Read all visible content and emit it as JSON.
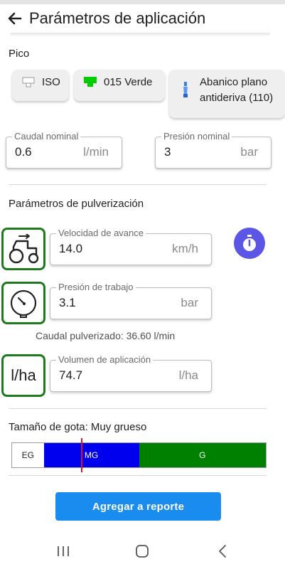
{
  "appbar": {
    "title": "Parámetros de aplicación"
  },
  "nozzle": {
    "section_label": "Pico",
    "chips": [
      {
        "label": "ISO",
        "icon": "nozzle-outline-icon",
        "color": "#ffffff"
      },
      {
        "label": "015 Verde",
        "icon": "nozzle-green-icon",
        "color": "#00cc00"
      },
      {
        "label_line1": "Abanico plano",
        "label_line2": "antideriva (110)",
        "icon": "fan-nozzle-icon",
        "color": "#3b7ee8"
      }
    ],
    "caudal_nominal": {
      "label": "Caudal nominal",
      "value": "0.6",
      "unit": "l/min"
    },
    "presion_nominal": {
      "label": "Presión nominal",
      "value": "3",
      "unit": "bar"
    }
  },
  "spray": {
    "section_label": "Parámetros de pulverización",
    "velocidad": {
      "label": "Velocidad de avance",
      "value": "14.0",
      "unit": "km/h",
      "icon": "tractor-icon"
    },
    "presion_trabajo": {
      "label": "Presión de trabajo",
      "value": "3.1",
      "unit": "bar",
      "icon": "pressure-gauge-icon"
    },
    "caudal_pulverizado": "Caudal pulverizado: 36.60 l/min",
    "volumen": {
      "label": "Volumen de aplicación",
      "value": "74.7",
      "unit": "l/ha",
      "icon_text": "l/ha"
    },
    "timer_icon": "stopwatch-icon",
    "accent_color": "#5b56e6",
    "icon_border_color": "#1d7a1d"
  },
  "droplet": {
    "label": "Tamaño de gota: Muy grueso",
    "segments": [
      {
        "label": "EG",
        "color": "#ffffff",
        "text_color": "#222222",
        "fraction": 0.125
      },
      {
        "label": "MG",
        "color": "#0000ee",
        "text_color": "#ffffff",
        "fraction": 0.375
      },
      {
        "label": "G",
        "color": "#008000",
        "text_color": "#ffffff",
        "fraction": 0.5
      }
    ],
    "marker_color": "#e0102a"
  },
  "actions": {
    "add_report": "Agregar a reporte",
    "button_color": "#1a8cf0"
  },
  "navbar": {
    "icons": [
      "recent-apps-icon",
      "home-icon",
      "back-nav-icon"
    ]
  }
}
